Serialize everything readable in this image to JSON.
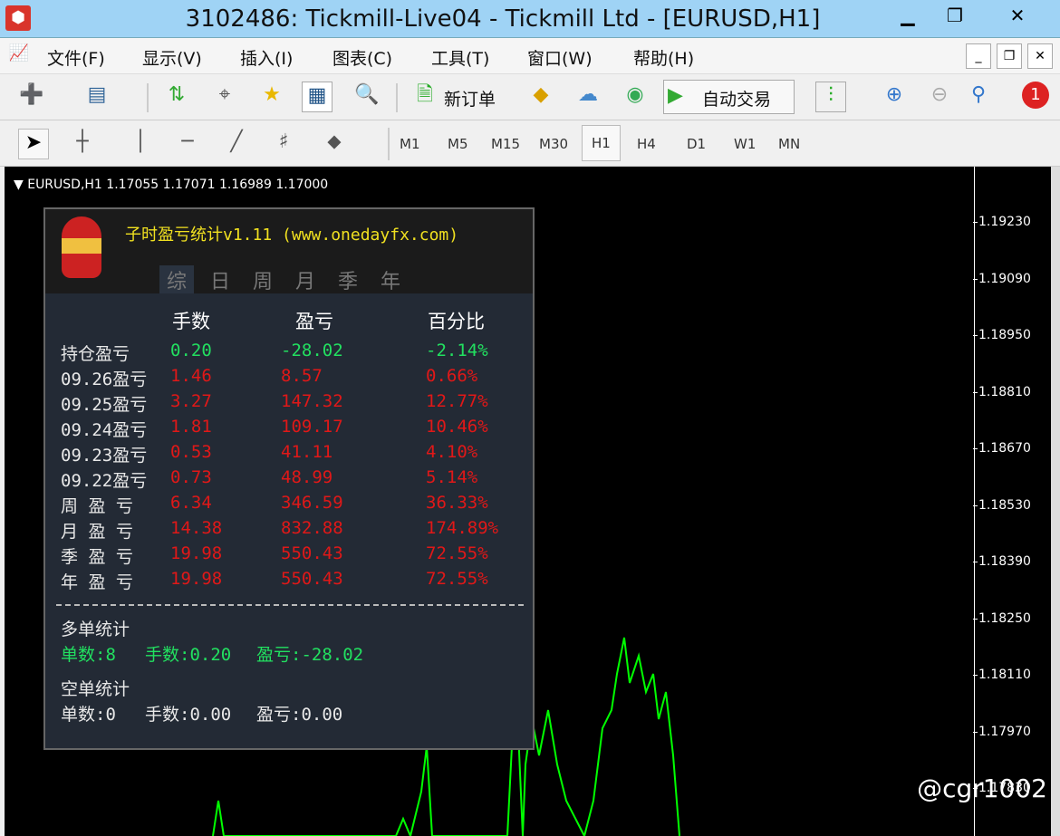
{
  "window": {
    "title": "3102486: Tickmill-Live04 - Tickmill Ltd - [EURUSD,H1]",
    "min": "▁",
    "max": "❐",
    "close": "✕"
  },
  "menu": [
    "文件(F)",
    "显示(V)",
    "插入(I)",
    "图表(C)",
    "工具(T)",
    "窗口(W)",
    "帮助(H)"
  ],
  "toolbar": {
    "new_order": "新订单",
    "auto_trading": "自动交易",
    "notification_count": "1"
  },
  "timeframes": [
    "M1",
    "M5",
    "M15",
    "M30",
    "H1",
    "H4",
    "D1",
    "W1",
    "MN"
  ],
  "active_timeframe": "H1",
  "chart": {
    "symbol_line": "EURUSD,H1  1.17055 1.17071 1.16989 1.17000",
    "price_ticks": [
      "1.19230",
      "1.19090",
      "1.18950",
      "1.18810",
      "1.18670",
      "1.18530",
      "1.18390",
      "1.18250",
      "1.18110",
      "1.17970",
      "1.17830"
    ]
  },
  "panel": {
    "title": "子时盈亏统计v1.11 (www.onedayfx.com)",
    "tabs": [
      "综",
      "日",
      "周",
      "月",
      "季",
      "年"
    ],
    "headers": [
      "手数",
      "盈亏",
      "百分比"
    ],
    "rows": [
      {
        "label": "持仓盈亏",
        "lots": "0.20",
        "pnl": "-28.02",
        "pct": "-2.14%",
        "color": "g"
      },
      {
        "label": "09.26盈亏",
        "lots": "1.46",
        "pnl": "8.57",
        "pct": "0.66%",
        "color": "r"
      },
      {
        "label": "09.25盈亏",
        "lots": "3.27",
        "pnl": "147.32",
        "pct": "12.77%",
        "color": "r"
      },
      {
        "label": "09.24盈亏",
        "lots": "1.81",
        "pnl": "109.17",
        "pct": "10.46%",
        "color": "r"
      },
      {
        "label": "09.23盈亏",
        "lots": "0.53",
        "pnl": "41.11",
        "pct": "4.10%",
        "color": "r"
      },
      {
        "label": "09.22盈亏",
        "lots": "0.73",
        "pnl": "48.99",
        "pct": "5.14%",
        "color": "r"
      },
      {
        "label": "周 盈 亏",
        "lots": "6.34",
        "pnl": "346.59",
        "pct": "36.33%",
        "color": "r"
      },
      {
        "label": "月 盈 亏",
        "lots": "14.38",
        "pnl": "832.88",
        "pct": "174.89%",
        "color": "r"
      },
      {
        "label": "季 盈 亏",
        "lots": "19.98",
        "pnl": "550.43",
        "pct": "72.55%",
        "color": "r"
      },
      {
        "label": "年 盈 亏",
        "lots": "19.98",
        "pnl": "550.43",
        "pct": "72.55%",
        "color": "r"
      }
    ],
    "long": {
      "title": "多单统计",
      "count": "单数:8",
      "lots": "手数:0.20",
      "pnl": "盈亏:-28.02"
    },
    "short": {
      "title": "空单统计",
      "count": "单数:0",
      "lots": "手数:0.00",
      "pnl": "盈亏:0.00"
    }
  },
  "watermark": "@cgr1002"
}
